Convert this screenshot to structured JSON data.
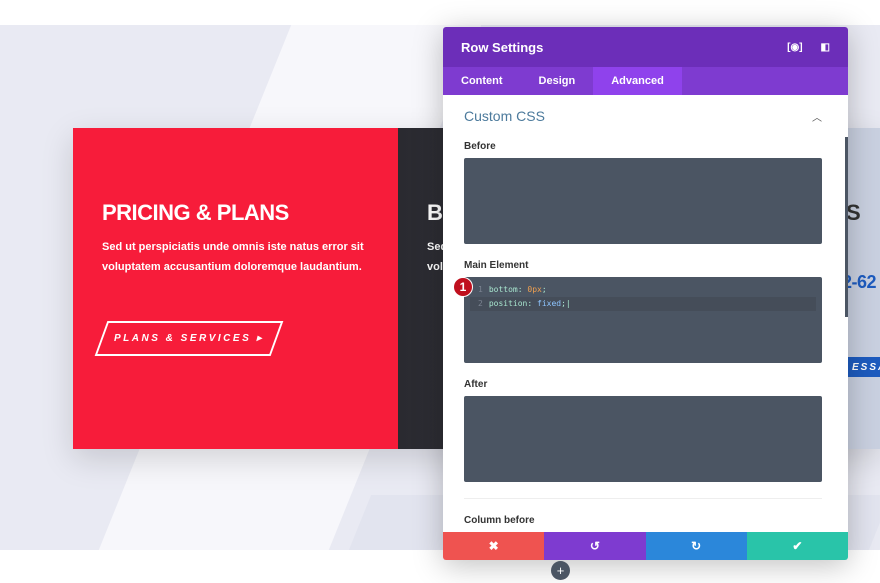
{
  "page": {
    "pricing_title": "PRICING & PLANS",
    "pricing_text_1": "Sed ut perspiciatis unde omnis iste natus error sit",
    "pricing_text_2": "voluptatem accusantium doloremque laudantium.",
    "cta_label": "PLANS & SERVICES ▸",
    "second_title_partial": "B",
    "second_text_1": "Sed",
    "second_text_2": "vol",
    "right_title_partial": "S",
    "phone_partial": "2-62",
    "right_button_partial": "ESSA"
  },
  "modal": {
    "title": "Row Settings",
    "tabs": [
      {
        "label": "Content"
      },
      {
        "label": "Design"
      },
      {
        "label": "Advanced"
      }
    ],
    "active_tab": "Advanced",
    "section": "Custom CSS",
    "fields": {
      "before": "Before",
      "main": "Main Element",
      "after": "After",
      "column_before": "Column before"
    },
    "code": [
      {
        "n": "1",
        "prop": "bottom:",
        "val": "0px"
      },
      {
        "n": "2",
        "prop": "position:",
        "val": "fixed"
      }
    ],
    "badge": "1",
    "footer": {
      "cancel": "✖",
      "undo": "↺",
      "redo": "↻",
      "save": "✔"
    }
  },
  "colors": {
    "purple": "#6c2eb9",
    "red": "#f71c3a",
    "cancel": "#ef5350",
    "undo": "#7e3bd0",
    "redo": "#2b87da",
    "save": "#29c4a9"
  },
  "add_button": "+"
}
